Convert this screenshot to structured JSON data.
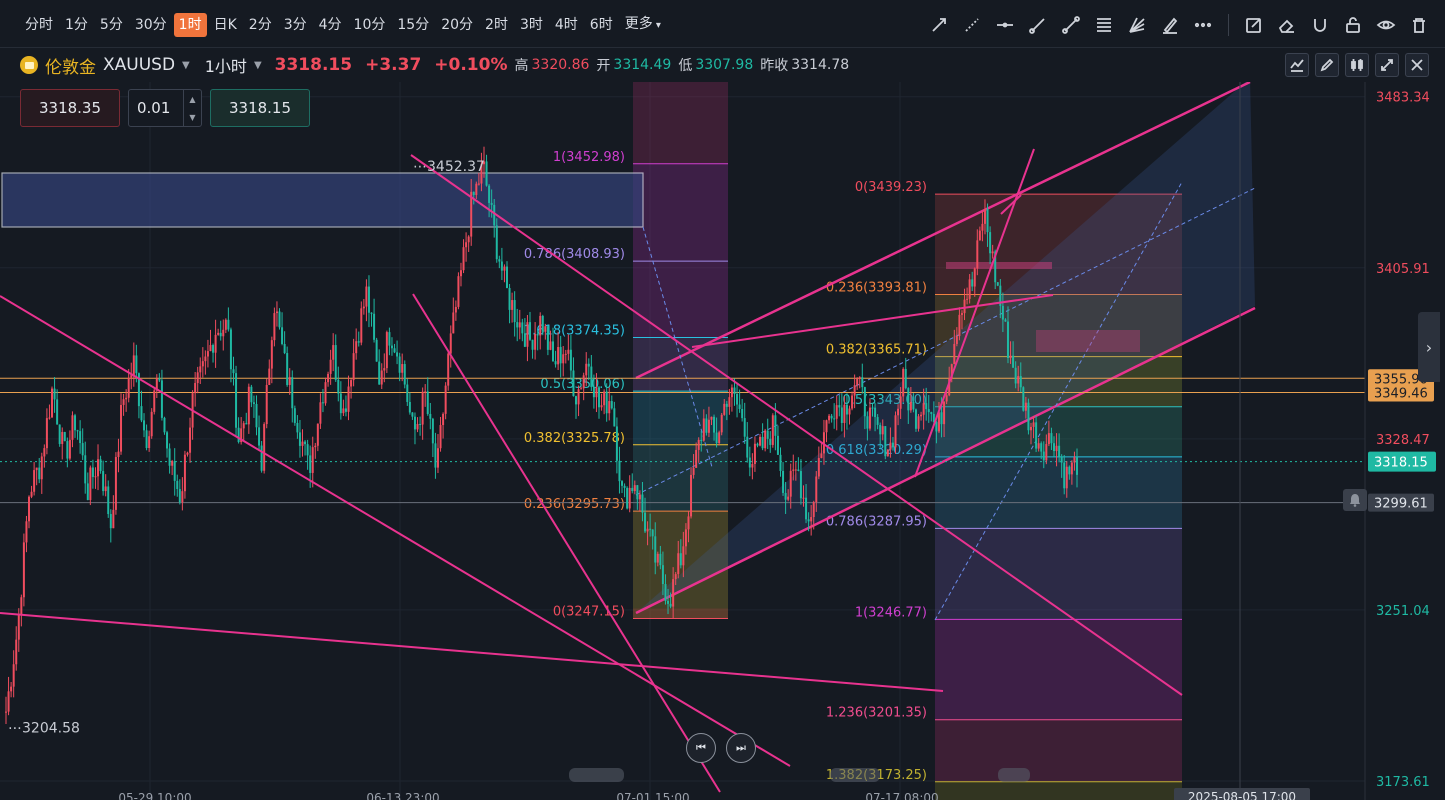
{
  "toolbar": {
    "timeframes": [
      "分时",
      "1分",
      "5分",
      "30分",
      "1时",
      "日K",
      "2分",
      "3分",
      "4分",
      "10分",
      "15分",
      "20分",
      "2时",
      "3时",
      "4时",
      "6时",
      "更多"
    ],
    "active_timeframe": "1时",
    "drawing_tools": [
      "trend-line-icon",
      "dashed-line-icon",
      "horizontal-line-icon",
      "ray-icon",
      "segment-icon",
      "fibonacci-icon",
      "fan-icon",
      "brush-icon",
      "more-icon",
      "edit-icon",
      "eraser-icon",
      "magnet-icon",
      "lock-icon",
      "eye-icon",
      "trash-icon"
    ]
  },
  "symbol": {
    "name": "伦敦金",
    "code": "XAUUSD",
    "interval": "1小时",
    "price": "3318.15",
    "change": "+3.37",
    "change_pct": "+0.10%",
    "high_label": "高",
    "high": "3320.86",
    "open_label": "开",
    "open": "3314.49",
    "low_label": "低",
    "low": "3307.98",
    "prev_close_label": "昨收",
    "prev_close": "3314.78"
  },
  "trade": {
    "sell_price": "3318.35",
    "quantity": "0.01",
    "buy_price": "3318.15"
  },
  "colors": {
    "up": "#f04d5e",
    "down": "#1fb9a3",
    "accent": "#f0743c",
    "trend": "#e8338f"
  },
  "chart_data": {
    "type": "candlestick",
    "symbol": "XAUUSD",
    "interval": "1小时",
    "y_range": [
      3165,
      3490
    ],
    "price_axis_labels": [
      "3483.34",
      "3405.91",
      "3328.47",
      "3251.04",
      "3173.61"
    ],
    "x_tick_labels": [
      "05-29 10:00",
      "06-13 23:00",
      "07-01 15:00",
      "07-17 08:00"
    ],
    "crosshair_time": "2025-08-05 17:00",
    "last_price": "3318.15",
    "marked_levels": [
      {
        "label": "3355.90",
        "value": 3355.9
      },
      {
        "label": "3349.46",
        "value": 3349.46
      },
      {
        "label": "3299.61",
        "value": 3299.61
      }
    ],
    "annotations": [
      {
        "text": "3452.37",
        "value": 3452.37
      },
      {
        "text": "3204.58",
        "value": 3204.58
      }
    ],
    "close_path": [
      3205,
      3243,
      3305,
      3318,
      3352,
      3320,
      3338,
      3305,
      3320,
      3290,
      3345,
      3363,
      3328,
      3355,
      3318,
      3302,
      3345,
      3360,
      3378,
      3380,
      3328,
      3348,
      3318,
      3392,
      3360,
      3338,
      3314,
      3345,
      3370,
      3340,
      3372,
      3395,
      3355,
      3378,
      3362,
      3330,
      3348,
      3312,
      3365,
      3400,
      3435,
      3452,
      3420,
      3395,
      3382,
      3373,
      3383,
      3362,
      3370,
      3348,
      3365,
      3342,
      3348,
      3300,
      3310,
      3288,
      3270,
      3256,
      3275,
      3312,
      3338,
      3328,
      3350,
      3342,
      3318,
      3325,
      3335,
      3302,
      3315,
      3290,
      3325,
      3345,
      3342,
      3355,
      3340,
      3330,
      3325,
      3355,
      3338,
      3349,
      3330,
      3360,
      3390,
      3398,
      3432,
      3402,
      3372,
      3352,
      3335,
      3325,
      3330,
      3311,
      3318
    ],
    "fibonacci": [
      {
        "name": "fib-left",
        "levels": [
          {
            "ratio": "1",
            "price": "3452.98",
            "value": 3452.98
          },
          {
            "ratio": "0.786",
            "price": "3408.93",
            "value": 3408.93
          },
          {
            "ratio": "1.618",
            "price": "3374.35",
            "value": 3374.35
          },
          {
            "ratio": "0.5",
            "price": "3350.06",
            "value": 3350.06
          },
          {
            "ratio": "0.382",
            "price": "3325.78",
            "value": 3325.78
          },
          {
            "ratio": "0.236",
            "price": "3295.73",
            "value": 3295.73
          },
          {
            "ratio": "0",
            "price": "3247.15",
            "value": 3247.15
          }
        ]
      },
      {
        "name": "fib-right",
        "levels": [
          {
            "ratio": "0",
            "price": "3439.23",
            "value": 3439.23
          },
          {
            "ratio": "0.236",
            "price": "3393.81",
            "value": 3393.81
          },
          {
            "ratio": "0.382",
            "price": "3365.71",
            "value": 3365.71
          },
          {
            "ratio": "0.5",
            "price": "3343.00",
            "value": 3343.0
          },
          {
            "ratio": "0.618",
            "price": "3320.29",
            "value": 3320.29
          },
          {
            "ratio": "0.786",
            "price": "3287.95",
            "value": 3287.95
          },
          {
            "ratio": "1",
            "price": "3246.77",
            "value": 3246.77
          },
          {
            "ratio": "1.236",
            "price": "3201.35",
            "value": 3201.35
          },
          {
            "ratio": "1.382",
            "price": "3173.25",
            "value": 3173.25
          }
        ]
      }
    ]
  }
}
